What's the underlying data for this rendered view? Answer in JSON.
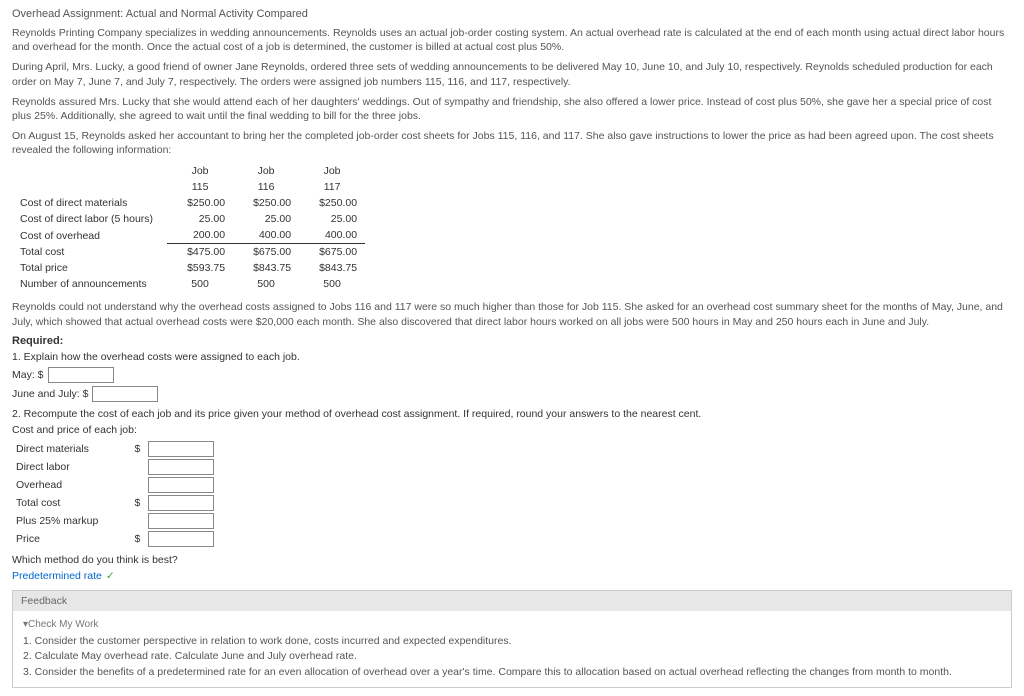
{
  "title": "Overhead Assignment: Actual and Normal Activity Compared",
  "p1": "Reynolds Printing Company specializes in wedding announcements. Reynolds uses an actual job-order costing system. An actual overhead rate is calculated at the end of each month using actual direct labor hours and overhead for the month. Once the actual cost of a job is determined, the customer is billed at actual cost plus 50%.",
  "p2": "During April, Mrs. Lucky, a good friend of owner Jane Reynolds, ordered three sets of wedding announcements to be delivered May 10, June 10, and July 10, respectively. Reynolds scheduled production for each order on May 7, June 7, and July 7, respectively. The orders were assigned job numbers 115, 116, and 117, respectively.",
  "p3": "Reynolds assured Mrs. Lucky that she would attend each of her daughters' weddings. Out of sympathy and friendship, she also offered a lower price. Instead of cost plus 50%, she gave her a special price of cost plus 25%. Additionally, she agreed to wait until the final wedding to bill for the three jobs.",
  "p4": "On August 15, Reynolds asked her accountant to bring her the completed job-order cost sheets for Jobs 115, 116, and 117. She also gave instructions to lower the price as had been agreed upon. The cost sheets revealed the following information:",
  "table": {
    "h1a": "Job",
    "h1b": "Job",
    "h1c": "Job",
    "h2a": "115",
    "h2b": "116",
    "h2c": "117",
    "r1l": "Cost of direct materials",
    "r1a": "$250.00",
    "r1b": "$250.00",
    "r1c": "$250.00",
    "r2l": "Cost of direct labor (5 hours)",
    "r2a": "25.00",
    "r2b": "25.00",
    "r2c": "25.00",
    "r3l": "Cost of overhead",
    "r3a": "200.00",
    "r3b": "400.00",
    "r3c": "400.00",
    "r4l": "Total cost",
    "r4a": "$475.00",
    "r4b": "$675.00",
    "r4c": "$675.00",
    "r5l": "Total price",
    "r5a": "$593.75",
    "r5b": "$843.75",
    "r5c": "$843.75",
    "r6l": "Number of announcements",
    "r6a": "500",
    "r6b": "500",
    "r6c": "500"
  },
  "p5": "Reynolds could not understand why the overhead costs assigned to Jobs 116 and 117 were so much higher than those for Job 115. She asked for an overhead cost summary sheet for the months of May, June, and July, which showed that actual overhead costs were $20,000 each month. She also discovered that direct labor hours worked on all jobs were 500 hours in May and 250 hours each in June and July.",
  "required": "Required:",
  "q1": "1. Explain how the overhead costs were assigned to each job.",
  "may": "May: $",
  "june": "June and July: $",
  "q2": "2. Recompute the cost of each job and its price given your method of overhead cost assignment. If required, round your answers to the nearest cent.",
  "recomp": {
    "hdr": "Cost and price of each job:",
    "r1": "Direct materials",
    "r2": "Direct labor",
    "r3": "Overhead",
    "r4": "Total cost",
    "r5": "Plus 25% markup",
    "r6": "Price"
  },
  "q3": "Which method do you think is best?",
  "ans3": "Predetermined rate",
  "check": "✓",
  "feedback": {
    "hdr": "Feedback",
    "sub": "▾Check My Work",
    "l1": "1. Consider the customer perspective in relation to work done, costs incurred and expected expenditures.",
    "l2": "2. Calculate May overhead rate. Calculate June and July overhead rate.",
    "l3": "3. Consider the benefits of a predetermined rate for an even allocation of overhead over a year's time. Compare this to allocation based on actual overhead reflecting the changes from month to month."
  }
}
